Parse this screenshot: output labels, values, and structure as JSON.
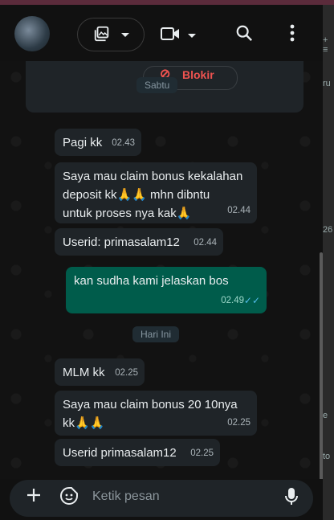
{
  "chat": {
    "profile": {
      "block_label": "Blokir"
    },
    "date_separators": [
      "Sabtu",
      "Hari Ini"
    ],
    "messages": [
      {
        "text": "Pagi kk",
        "time": "02.43",
        "direction": "in"
      },
      {
        "text": "Saya mau claim bonus kekalahan\ndeposit kk🙏🙏 mhn dibntu\nuntuk proses nya kak🙏",
        "time": "02.44",
        "direction": "in"
      },
      {
        "text": "Userid: primasalam12",
        "time": "02.44",
        "direction": "in"
      },
      {
        "text": "kan sudha kami jelaskan bos",
        "time": "02.49",
        "direction": "out",
        "status": "read"
      },
      {
        "text": "MLM kk",
        "time": "02.25",
        "direction": "in"
      },
      {
        "text": "Saya mau claim bonus 20 10nya\nkk🙏🙏",
        "time": "02.25",
        "direction": "in"
      },
      {
        "text": "Userid primasalam12",
        "time": "02.25",
        "direction": "in"
      }
    ]
  },
  "composer": {
    "placeholder": "Ketik pesan"
  },
  "icons": {
    "header": [
      "media-picker-icon",
      "video-call-icon",
      "search-icon",
      "more-vertical-icon"
    ],
    "composer": [
      "plus-icon",
      "sticker-icon",
      "mic-icon"
    ]
  },
  "colors": {
    "outgoing": "#005c4b",
    "incoming": "#1f2428",
    "read_ticks": "#53bdeb",
    "block": "#ef5350"
  },
  "edge_fragments": [
    "+ ≡",
    "ru",
    "26",
    "e",
    "to"
  ]
}
